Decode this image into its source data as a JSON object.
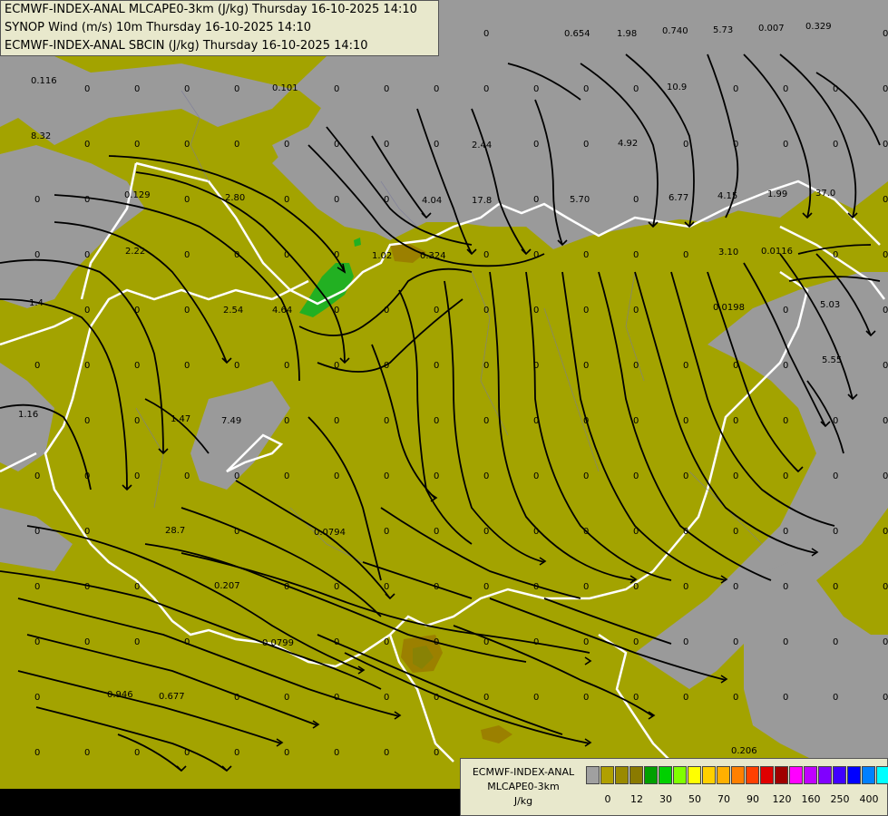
{
  "header": {
    "line1": "ECMWF-INDEX-ANAL MLCAPE0-3km (J/kg) Thursday 16-10-2025 14:10",
    "line2": "SYNOP Wind (m/s) 10m Thursday 16-10-2025 14:10",
    "line3": "ECMWF-INDEX-ANAL SBCIN (J/kg) Thursday 16-10-2025 14:10"
  },
  "legend": {
    "title1": "ECMWF-INDEX-ANAL",
    "title2": "MLCAPE0-3km",
    "unit": "J/kg",
    "swatch_colors": [
      "#a0a0a0",
      "#b0a000",
      "#9a8a00",
      "#8a7a00",
      "#00a000",
      "#00d000",
      "#80ff00",
      "#ffff00",
      "#ffd000",
      "#ffb000",
      "#ff8000",
      "#ff4000",
      "#e00000",
      "#a00000",
      "#ff00ff",
      "#c000ff",
      "#8000ff",
      "#4000ff",
      "#0000ff",
      "#0080ff",
      "#00ffff",
      "#80ffff",
      "#ffffff"
    ],
    "ticks": [
      "0",
      "12",
      "30",
      "50",
      "70",
      "90",
      "120",
      "160",
      "250",
      "400"
    ]
  },
  "colors": {
    "cape_low": "#a3a300",
    "no_data": "#9a9a9a",
    "green": "#22b022",
    "border": "#ffffff",
    "streamline": "#000000"
  },
  "map": {
    "sbcin_labels": [
      "0.116",
      "0.101",
      "8.32",
      "0.129",
      "2.80",
      "2.22",
      "1.4",
      "2.54",
      "4.64",
      "1.16",
      "1.47",
      "7.49",
      "0.654",
      "1.98",
      "0.740",
      "5.73",
      "0.007",
      "0.329",
      "10.9",
      "2.44",
      "4.92",
      "4.04",
      "17.8",
      "5.70",
      "6.77",
      "4.15",
      "1.99",
      "37.0",
      "1.02",
      "0.324",
      "3.10",
      "0.0116",
      "0.0198",
      "5.03",
      "5.55",
      "28.7",
      "0.0794",
      "0.207",
      "0.0799",
      "0.946",
      "0.677",
      "0.206",
      "0"
    ]
  }
}
